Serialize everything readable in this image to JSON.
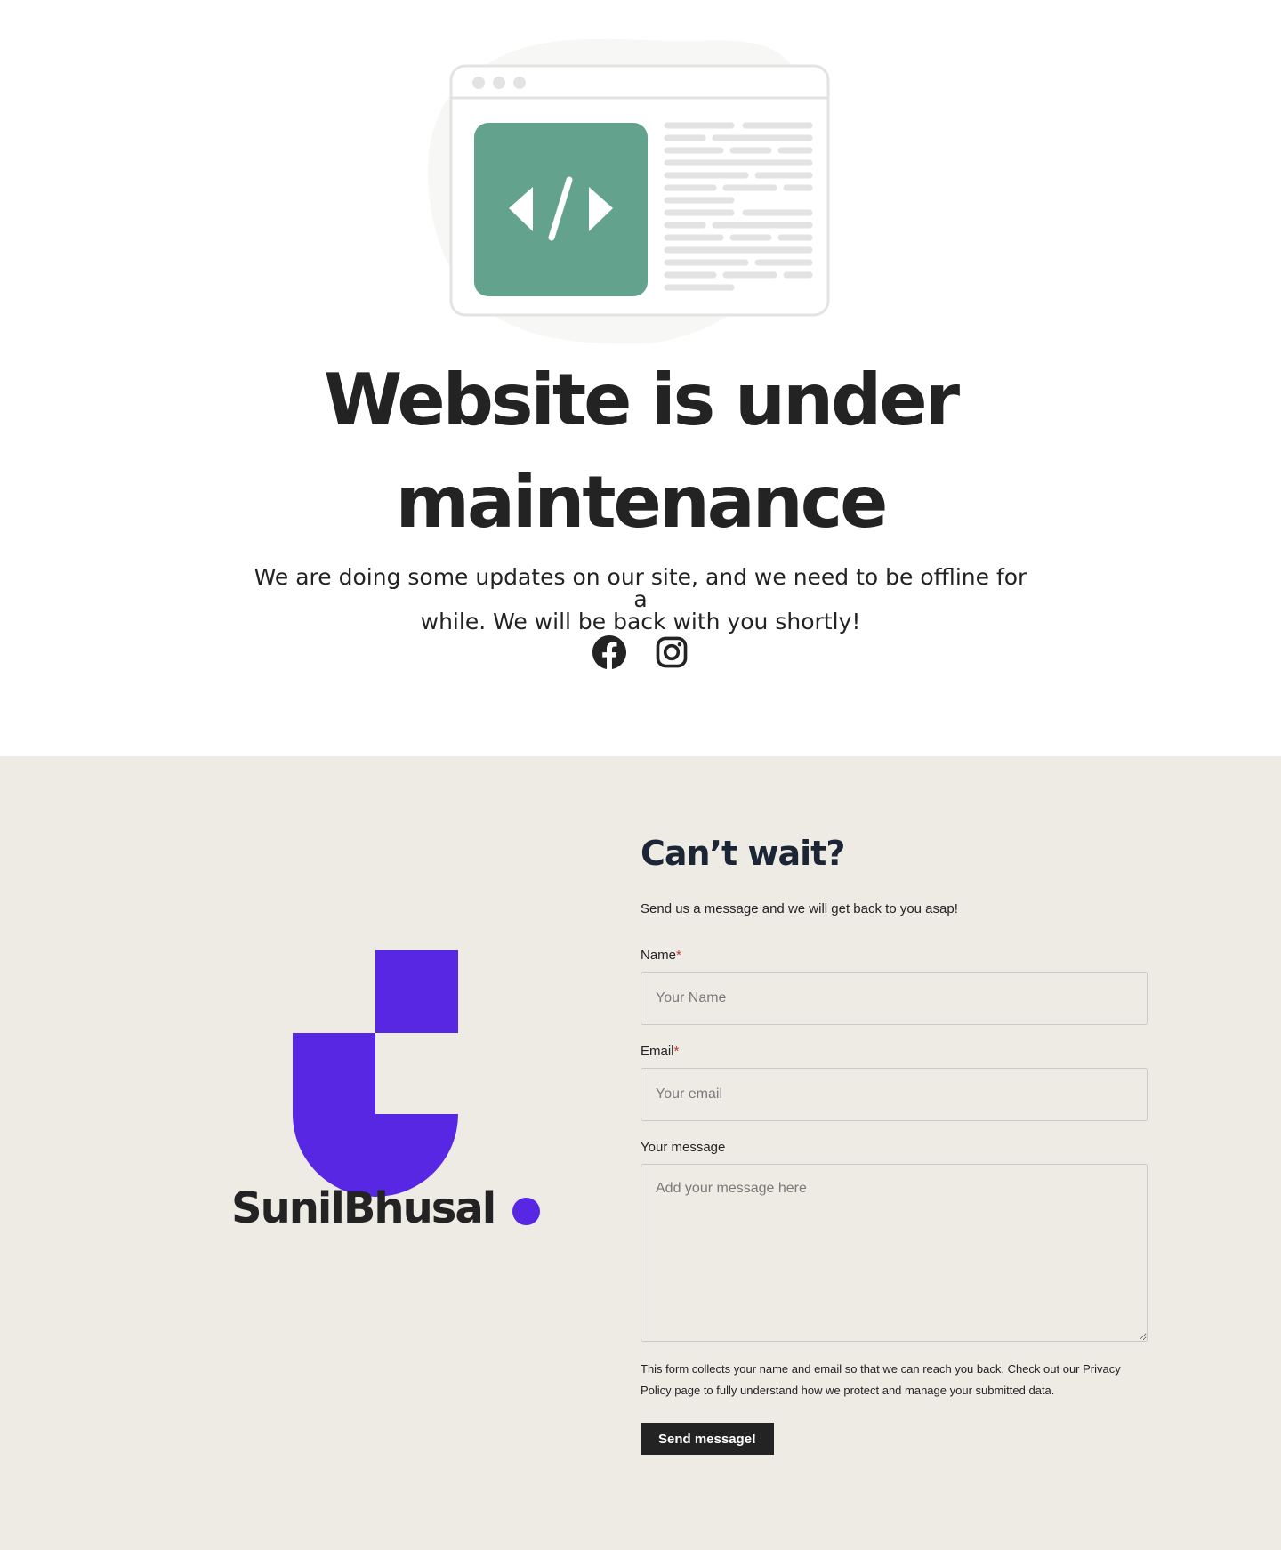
{
  "hero": {
    "title_line1": "Website is under",
    "title_line2": "maintenance",
    "subtitle_line1": "We are doing some updates on our site, and we need to be offline for a",
    "subtitle_line2": "while. We will be back with you shortly!",
    "social": [
      {
        "icon": "facebook-icon"
      },
      {
        "icon": "instagram-icon"
      }
    ],
    "illustration_accent": "#63a38e"
  },
  "brand": {
    "wordmark": "SunilBhusal",
    "color": "#5727e3"
  },
  "contact": {
    "title": "Can’t wait?",
    "lead": "Send us a message and we will get back to you asap!",
    "name_label": "Name",
    "name_required": "*",
    "name_placeholder": "Your Name",
    "email_label": "Email",
    "email_required": "*",
    "email_placeholder": "Your email",
    "message_label": "Your message",
    "message_placeholder": "Add your message here",
    "notice_line1": "This form collects your name and email so that we can reach you back. Check out our Privacy",
    "notice_line2": "Policy page to fully understand how we protect and manage your submitted data.",
    "submit_label": "Send message!",
    "background": "#eeebe5"
  }
}
